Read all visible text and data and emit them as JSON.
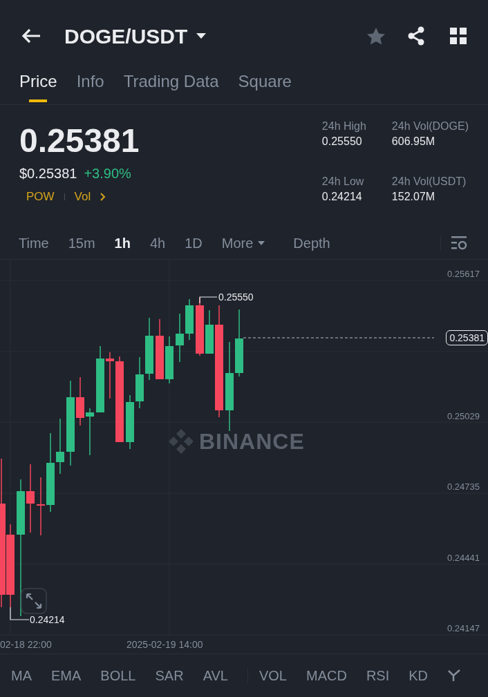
{
  "header": {
    "pair": "DOGE/USDT",
    "favorite": false
  },
  "tabs": [
    {
      "label": "Price",
      "selected": true
    },
    {
      "label": "Info",
      "selected": false
    },
    {
      "label": "Trading Data",
      "selected": false
    },
    {
      "label": "Square",
      "selected": false
    }
  ],
  "ticker": {
    "price": "0.25381",
    "fiat_price": "$0.25381",
    "change": "+3.90%",
    "tags": [
      "POW",
      "Vol"
    ]
  },
  "stats": [
    {
      "label": "24h High",
      "value": "0.25550"
    },
    {
      "label": "24h Vol(DOGE)",
      "value": "606.95M"
    },
    {
      "label": "24h Low",
      "value": "0.24214"
    },
    {
      "label": "24h Vol(USDT)",
      "value": "152.07M"
    }
  ],
  "intervals": [
    {
      "label": "Time",
      "selected": false,
      "kind": "interval"
    },
    {
      "label": "15m",
      "selected": false,
      "kind": "interval"
    },
    {
      "label": "1h",
      "selected": true,
      "kind": "interval"
    },
    {
      "label": "4h",
      "selected": false,
      "kind": "interval"
    },
    {
      "label": "1D",
      "selected": false,
      "kind": "interval"
    },
    {
      "label": "More",
      "selected": false,
      "kind": "dropdown"
    },
    {
      "label": "Depth",
      "selected": false,
      "kind": "view"
    }
  ],
  "chart": {
    "watermark": "BINANCE",
    "price_ticks": [
      "0.25617",
      "0.25029",
      "0.24735",
      "0.24441",
      "0.24147"
    ],
    "high_marker": "0.25550",
    "low_marker": "0.24214",
    "last_price": "0.25381",
    "time_labels": [
      "02-18 22:00",
      "2025-02-19 14:00"
    ]
  },
  "indicators": [
    "MA",
    "EMA",
    "BOLL",
    "SAR",
    "AVL",
    "VOL",
    "MACD",
    "RSI",
    "KD"
  ]
}
